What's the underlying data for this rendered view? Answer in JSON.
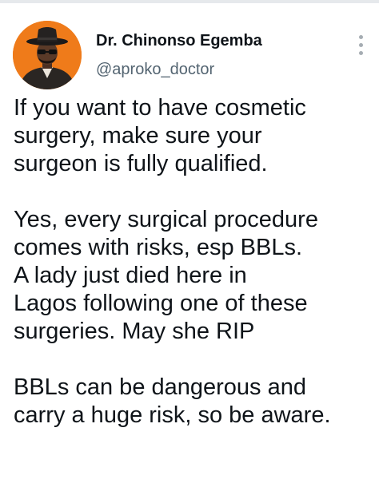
{
  "tweet": {
    "author": {
      "display_name": "Dr. Chinonso Egemba",
      "handle": "@aproko_doctor",
      "avatar_bg": "#ef7b1a"
    },
    "more_icon": "more-vertical-icon",
    "paragraphs": [
      [
        "If you want to have cosmetic",
        "surgery, make sure your",
        "surgeon is fully qualified."
      ],
      [
        "Yes, every surgical procedure",
        "comes with risks, esp BBLs.",
        "A lady just died here in",
        "Lagos following one of these",
        "surgeries. May she RIP"
      ],
      [
        "BBLs can be dangerous and",
        "carry a huge risk, so be aware."
      ]
    ]
  }
}
